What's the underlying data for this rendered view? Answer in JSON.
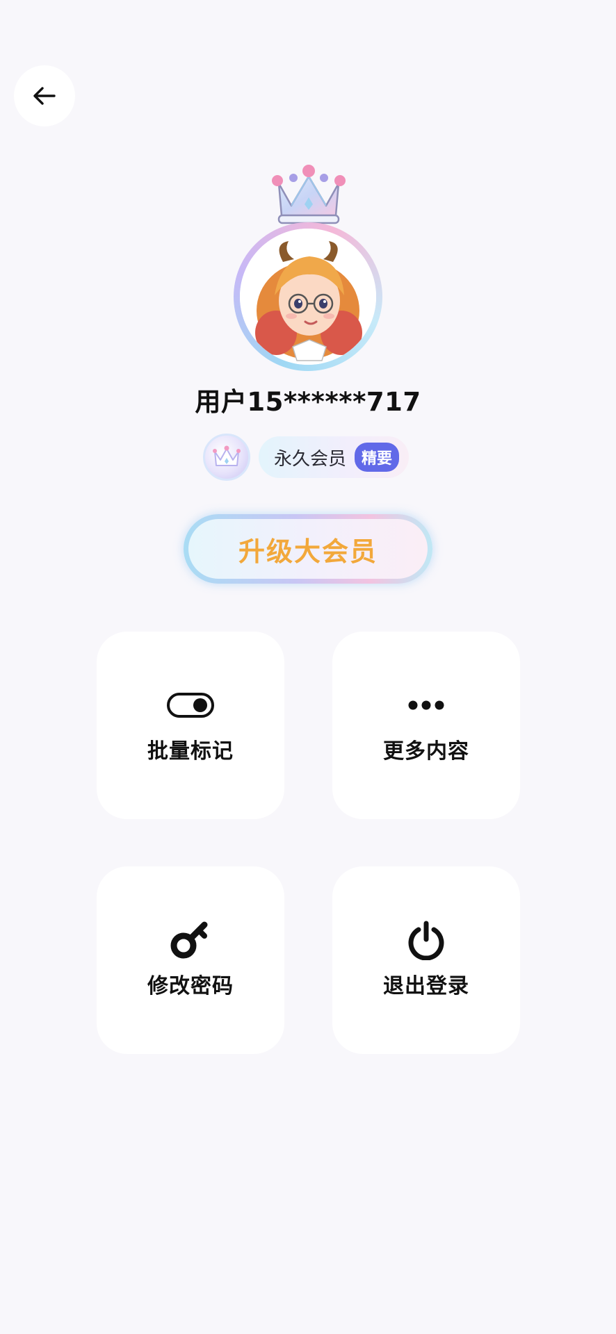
{
  "header": {
    "back_icon": "arrow-left-icon"
  },
  "profile": {
    "crown_icon": "crown-icon",
    "avatar_alt": "avatar",
    "username": "用户15******717"
  },
  "membership": {
    "badge_icon": "crown-badge-icon",
    "label": "永久会员",
    "tag": "精要"
  },
  "upgrade": {
    "label": "升级大会员"
  },
  "menu": {
    "batch_mark": {
      "icon": "toggle-icon",
      "label": "批量标记"
    },
    "more_content": {
      "icon": "more-dots-icon",
      "label": "更多内容"
    },
    "change_password": {
      "icon": "key-icon",
      "label": "修改密码"
    },
    "logout": {
      "icon": "power-icon",
      "label": "退出登录"
    }
  },
  "colors": {
    "background": "#f8f7fb",
    "upgrade_text": "#f2a83b",
    "vip_tag": "#6169e8"
  }
}
